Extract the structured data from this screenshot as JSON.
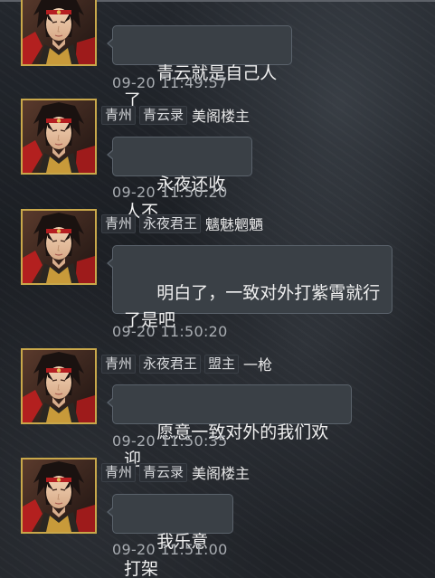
{
  "messages": [
    {
      "tags": [],
      "name": "",
      "text": "青云就是自己人了",
      "time": "09-20 11:49:57"
    },
    {
      "tags": [
        "青州",
        "青云录"
      ],
      "name": "美阁楼主",
      "text": "永夜还收人不",
      "time": "09-20 11:50:20"
    },
    {
      "tags": [
        "青州",
        "永夜君王"
      ],
      "name": "魑魅魍魉",
      "text": "明白了，一致对外打紫霄就行\n了是吧",
      "time": "09-20 11:50:20"
    },
    {
      "tags": [
        "青州",
        "永夜君王",
        "盟主"
      ],
      "name": "一枪",
      "text": "愿意一致对外的我们欢迎",
      "time": "09-20 11:50:35"
    },
    {
      "tags": [
        "青州",
        "青云录"
      ],
      "name": "美阁楼主",
      "text": "我乐意打架",
      "time": "09-20 11:51:00"
    }
  ]
}
